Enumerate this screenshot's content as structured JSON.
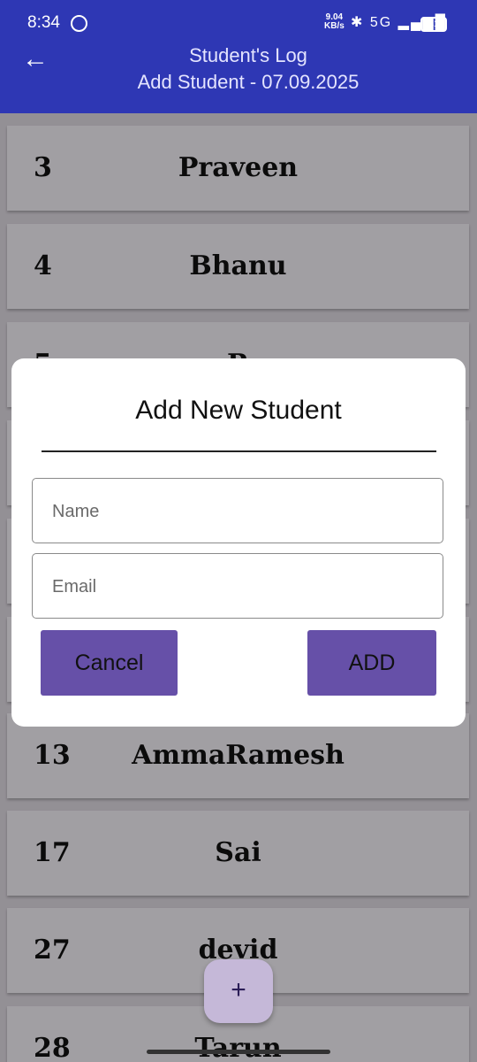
{
  "status_bar": {
    "time": "8:34",
    "speed_value": "9.04",
    "speed_unit": "KB/s",
    "network": "5G",
    "battery": "41"
  },
  "app_bar": {
    "title": "Student's Log",
    "subtitle": "Add Student - 07.09.2025"
  },
  "students": [
    {
      "id": "3",
      "name": "Praveen"
    },
    {
      "id": "4",
      "name": "Bhanu"
    },
    {
      "id": "5",
      "name": "R"
    },
    {
      "id": "",
      "name": ""
    },
    {
      "id": "",
      "name": ""
    },
    {
      "id": "",
      "name": ""
    },
    {
      "id": "13",
      "name": "AmmaRamesh"
    },
    {
      "id": "17",
      "name": "Sai"
    },
    {
      "id": "27",
      "name": "devid"
    },
    {
      "id": "28",
      "name": "Tarun"
    }
  ],
  "dialog": {
    "title": "Add New Student",
    "name_placeholder": "Name",
    "email_placeholder": "Email",
    "cancel_label": "Cancel",
    "add_label": "ADD"
  },
  "fab": {
    "label": "+"
  },
  "colors": {
    "app_bar": "#2e37b4",
    "button": "#6650a8",
    "fab": "#c5b8d8",
    "row": "#f1eef3"
  }
}
